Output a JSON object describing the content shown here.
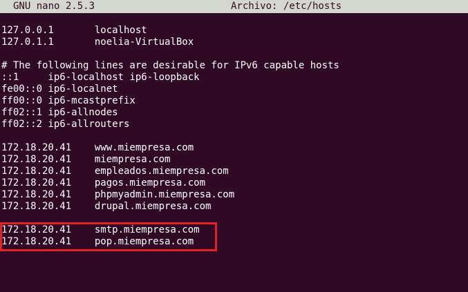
{
  "titlebar": {
    "app_version": "GNU nano 2.5.3",
    "file_label": "Archivo: /etc/hosts"
  },
  "lines": [
    "127.0.0.1       localhost",
    "127.0.1.1       noelia-VirtualBox",
    "",
    "# The following lines are desirable for IPv6 capable hosts",
    "::1     ip6-localhost ip6-loopback",
    "fe00::0 ip6-localnet",
    "ff00::0 ip6-mcastprefix",
    "ff02::1 ip6-allnodes",
    "ff02::2 ip6-allrouters",
    "",
    "172.18.20.41    www.miempresa.com",
    "172.18.20.41    miempresa.com",
    "172.18.20.41    empleados.miempresa.com",
    "172.18.20.41    pagos.miempresa.com",
    "172.18.20.41    phpmyadmin.miempresa.com",
    "172.18.20.41    drupal.miempresa.com",
    "",
    "172.18.20.41    smtp.miempresa.com",
    "172.18.20.41    pop.miempresa.com"
  ],
  "colors": {
    "terminal_background": "#300a24",
    "terminal_text": "#ffffff",
    "titlebar_background": "#d3d7cf",
    "highlight_border": "#e32127"
  }
}
